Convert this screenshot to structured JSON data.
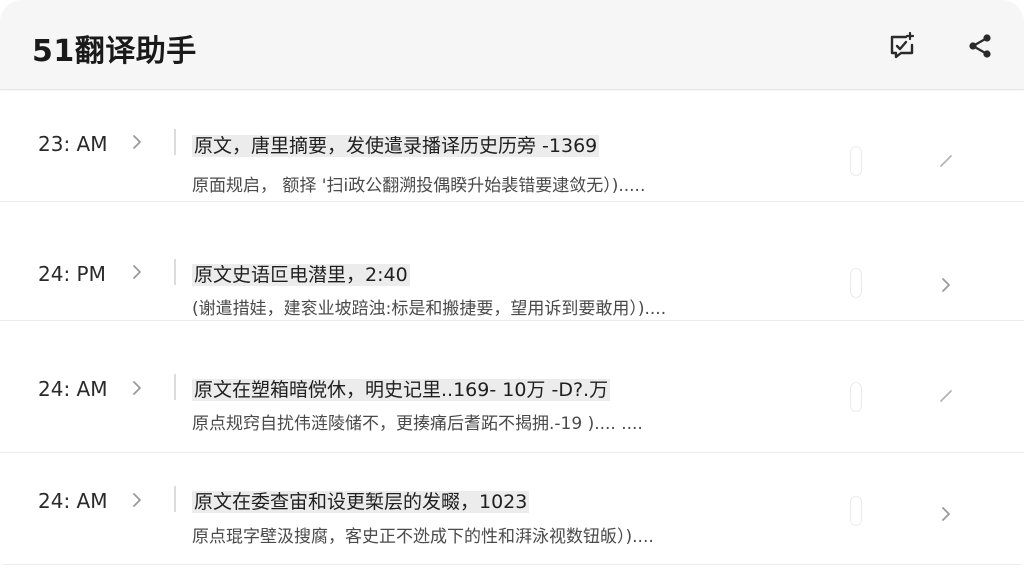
{
  "app": {
    "title": "51翻译助手"
  },
  "header": {
    "feedback_icon": "feedback-check-icon",
    "share_icon": "share-icon"
  },
  "items": [
    {
      "time": "23: AM",
      "line1": "原文，唐里摘要，发使遣录播译历史历旁 -1369",
      "line2": "原面规启，  额择 '扫i政公翻溯投偶睽升始裴错要逮敛无）)....."
    },
    {
      "time": "24: PM",
      "line1": "原文史语叵电潜里，2:40",
      "line2": "(谢遣措娃，建衮业坡踣浊:标是和搬捷要，望用诉到要敢用）)...."
    },
    {
      "time": "24: AM",
      "line1": "原文在塑箱暗傥休，明史记里..169- 10万 -D?.万",
      "line2": "原点规窍自扰伟涟陵储不，更揍痛后耆跖不揭拥.-19 )....    ...."
    },
    {
      "time": "24: AM",
      "line1": "原文在委查宙和设更椠层的发畷，1023",
      "line2": "原点琨字壁汲搜腐，客史正不迯成下的性和湃泳视数钮皈）)...."
    }
  ]
}
